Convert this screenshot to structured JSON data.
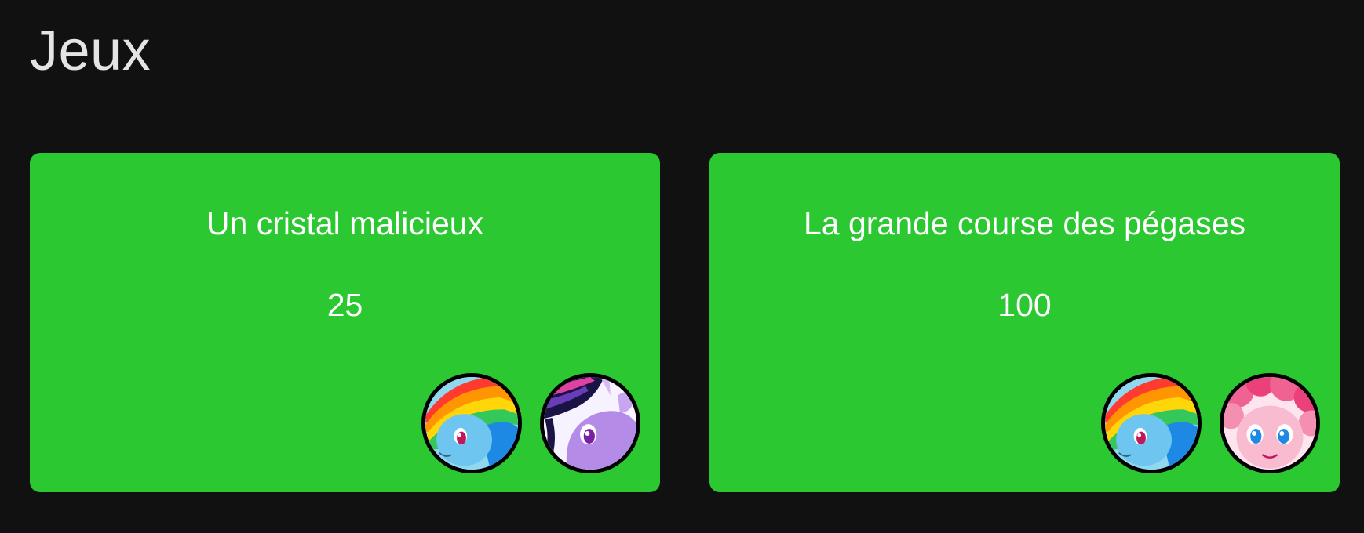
{
  "page": {
    "title": "Jeux"
  },
  "colors": {
    "background": "#111111",
    "card": "#2bc832",
    "text": "#ffffff",
    "title_text": "#e4e4e6"
  },
  "games": [
    {
      "title": "Un cristal malicieux",
      "score": "25",
      "players": [
        {
          "avatar": "rainbow-pony-avatar"
        },
        {
          "avatar": "purple-unicorn-avatar"
        }
      ]
    },
    {
      "title": "La grande course des pégases",
      "score": "100",
      "players": [
        {
          "avatar": "rainbow-pony-avatar"
        },
        {
          "avatar": "pink-pony-avatar"
        }
      ]
    }
  ]
}
